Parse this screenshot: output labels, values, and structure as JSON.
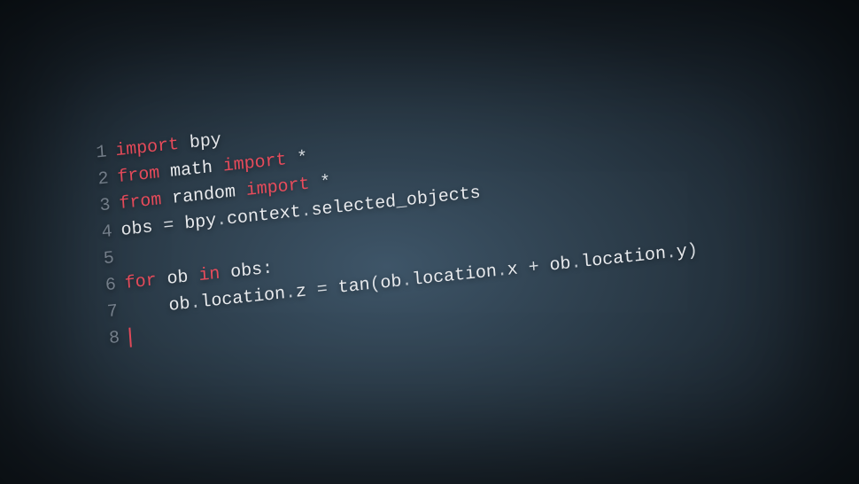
{
  "code": {
    "lines": [
      {
        "number": "1",
        "tokens": [
          {
            "type": "keyword",
            "text": "import"
          },
          {
            "type": "space",
            "text": " "
          },
          {
            "type": "identifier",
            "text": "bpy"
          }
        ]
      },
      {
        "number": "2",
        "tokens": [
          {
            "type": "keyword",
            "text": "from"
          },
          {
            "type": "space",
            "text": " "
          },
          {
            "type": "identifier",
            "text": "math"
          },
          {
            "type": "space",
            "text": " "
          },
          {
            "type": "keyword",
            "text": "import"
          },
          {
            "type": "space",
            "text": " "
          },
          {
            "type": "asterisk",
            "text": "*"
          }
        ]
      },
      {
        "number": "3",
        "tokens": [
          {
            "type": "keyword",
            "text": "from"
          },
          {
            "type": "space",
            "text": " "
          },
          {
            "type": "identifier",
            "text": "random"
          },
          {
            "type": "space",
            "text": " "
          },
          {
            "type": "keyword",
            "text": "import"
          },
          {
            "type": "space",
            "text": " "
          },
          {
            "type": "asterisk",
            "text": "*"
          }
        ]
      },
      {
        "number": "4",
        "tokens": [
          {
            "type": "identifier",
            "text": "obs"
          },
          {
            "type": "space",
            "text": " "
          },
          {
            "type": "operator",
            "text": "="
          },
          {
            "type": "space",
            "text": " "
          },
          {
            "type": "identifier",
            "text": "bpy"
          },
          {
            "type": "dot",
            "text": "."
          },
          {
            "type": "identifier",
            "text": "context"
          },
          {
            "type": "dot",
            "text": "."
          },
          {
            "type": "identifier",
            "text": "selected_objects"
          }
        ]
      },
      {
        "number": "5",
        "tokens": []
      },
      {
        "number": "6",
        "tokens": [
          {
            "type": "keyword",
            "text": "for"
          },
          {
            "type": "space",
            "text": " "
          },
          {
            "type": "identifier",
            "text": "ob"
          },
          {
            "type": "space",
            "text": " "
          },
          {
            "type": "keyword",
            "text": "in"
          },
          {
            "type": "space",
            "text": " "
          },
          {
            "type": "identifier",
            "text": "obs"
          },
          {
            "type": "operator",
            "text": ":"
          }
        ]
      },
      {
        "number": "7",
        "tokens": [
          {
            "type": "space",
            "text": "    "
          },
          {
            "type": "identifier",
            "text": "ob"
          },
          {
            "type": "dot",
            "text": "."
          },
          {
            "type": "identifier",
            "text": "location"
          },
          {
            "type": "dot",
            "text": "."
          },
          {
            "type": "identifier",
            "text": "z"
          },
          {
            "type": "space",
            "text": " "
          },
          {
            "type": "operator",
            "text": "="
          },
          {
            "type": "space",
            "text": " "
          },
          {
            "type": "identifier",
            "text": "tan"
          },
          {
            "type": "operator",
            "text": "("
          },
          {
            "type": "identifier",
            "text": "ob"
          },
          {
            "type": "dot",
            "text": "."
          },
          {
            "type": "identifier",
            "text": "location"
          },
          {
            "type": "dot",
            "text": "."
          },
          {
            "type": "identifier",
            "text": "x"
          },
          {
            "type": "space",
            "text": " "
          },
          {
            "type": "operator",
            "text": "+"
          },
          {
            "type": "space",
            "text": " "
          },
          {
            "type": "identifier",
            "text": "ob"
          },
          {
            "type": "dot",
            "text": "."
          },
          {
            "type": "identifier",
            "text": "location"
          },
          {
            "type": "dot",
            "text": "."
          },
          {
            "type": "identifier",
            "text": "y"
          },
          {
            "type": "operator",
            "text": ")"
          }
        ]
      },
      {
        "number": "8",
        "tokens": [
          {
            "type": "cursor",
            "text": ""
          }
        ]
      }
    ]
  }
}
